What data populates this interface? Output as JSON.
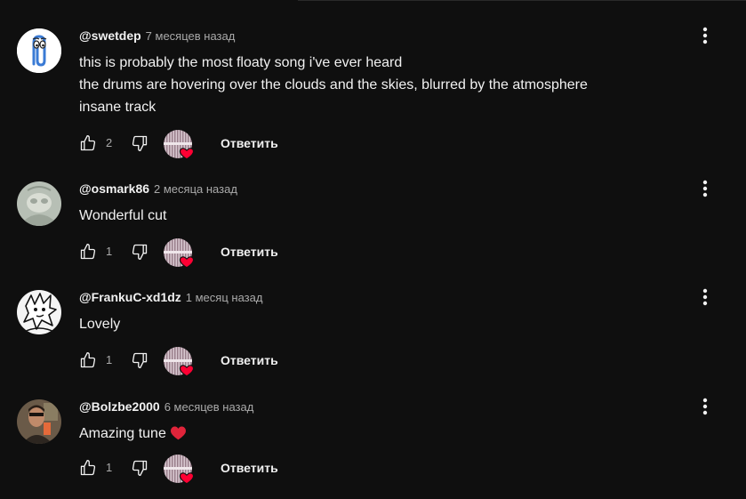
{
  "comments": [
    {
      "author": "@swetdep",
      "time": "7 месяцев назад",
      "lines": [
        "this is probably the most floaty song i've ever heard",
        "the drums are hovering over the clouds and the skies, blurred by the atmosphere",
        "insane track"
      ],
      "likes": "2",
      "reply_label": "Ответить",
      "avatar_icon": "paperclip-avatar"
    },
    {
      "author": "@osmark86",
      "time": "2 месяца назад",
      "lines": [
        "Wonderful cut"
      ],
      "likes": "1",
      "reply_label": "Ответить",
      "avatar_icon": "pale-sketch-avatar"
    },
    {
      "author": "@FrankuC-xd1dz",
      "time": "1 месяц назад",
      "lines": [
        "Lovely"
      ],
      "likes": "1",
      "reply_label": "Ответить",
      "avatar_icon": "anime-drawing-avatar"
    },
    {
      "author": "@Bolzbe2000",
      "time": "6 месяцев назад",
      "lines": [
        "Amazing tune"
      ],
      "likes": "1",
      "reply_label": "Ответить",
      "avatar_icon": "selfie-photo-avatar",
      "emoji": "red-heart-emoji"
    }
  ],
  "colors": {
    "background": "#0f0f0f",
    "text": "#f1f1f1",
    "secondary": "#aaaaaa",
    "heart": "#ff0033"
  }
}
